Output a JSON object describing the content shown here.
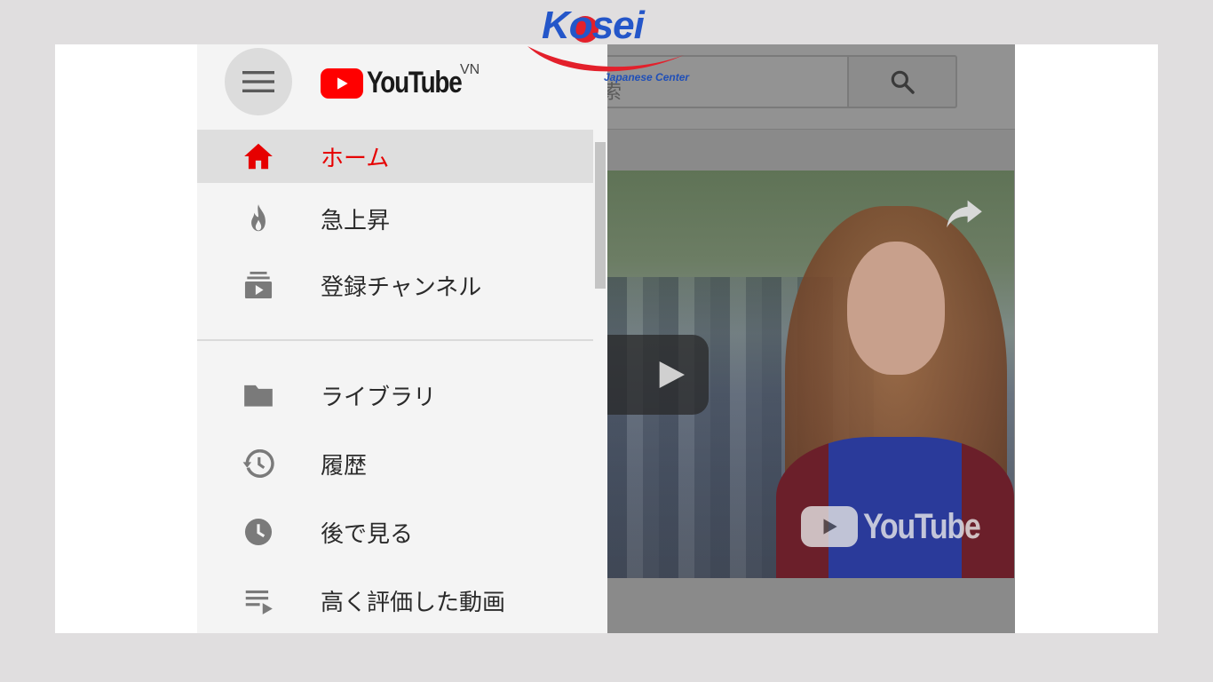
{
  "brand": {
    "logo_text": "YouTube",
    "region": "VN",
    "accent_color": "#ff0000"
  },
  "search": {
    "partial_text": "索",
    "button_icon": "search-icon"
  },
  "nav": {
    "primary": [
      {
        "label": "ホーム",
        "icon": "home-icon",
        "active": true
      },
      {
        "label": "急上昇",
        "icon": "trending-fire-icon",
        "active": false
      },
      {
        "label": "登録チャンネル",
        "icon": "subscriptions-icon",
        "active": false
      }
    ],
    "secondary": [
      {
        "label": "ライブラリ",
        "icon": "library-folder-icon",
        "active": false
      },
      {
        "label": "履歴",
        "icon": "history-icon",
        "active": false
      },
      {
        "label": "後で見る",
        "icon": "watch-later-clock-icon",
        "active": false
      },
      {
        "label": "高く評価した動画",
        "icon": "liked-videos-playlist-icon",
        "active": false
      }
    ]
  },
  "video": {
    "watermark_text": "YouTube"
  },
  "overlay_logo": {
    "title": "Kosei",
    "subtitle": "Japanese Center"
  }
}
